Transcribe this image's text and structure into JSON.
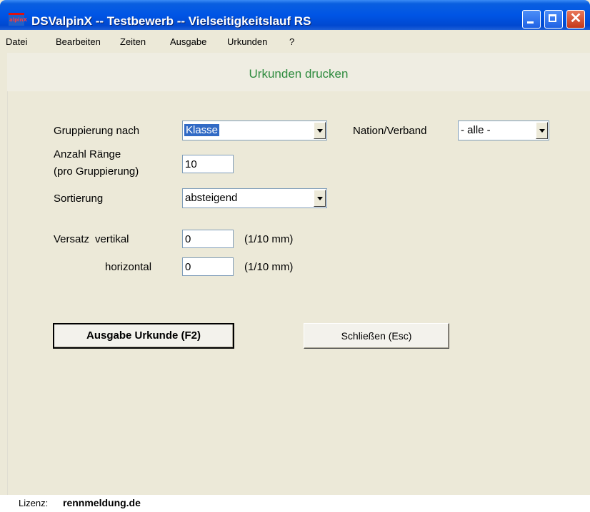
{
  "window": {
    "title": "DSValpinX -- Testbewerb -- Vielseitigkeitslauf RS",
    "icon_text": "alpinX"
  },
  "menu": [
    "Datei",
    "Bearbeiten",
    "Zeiten",
    "Ausgabe",
    "Urkunden",
    "?"
  ],
  "page": {
    "title": "Urkunden drucken"
  },
  "form": {
    "grouping": {
      "label": "Gruppierung nach",
      "value": "Klasse"
    },
    "nation": {
      "label": "Nation/Verband",
      "value": "- alle -"
    },
    "ranks": {
      "label_line1": "Anzahl Ränge",
      "label_line2": "(pro Gruppierung)",
      "value": "10"
    },
    "sort": {
      "label": "Sortierung",
      "value": "absteigend"
    },
    "offset": {
      "label": "Versatz",
      "vertical_label": "vertikal",
      "vertical_value": "0",
      "horizontal_label": "horizontal",
      "horizontal_value": "0",
      "unit": "(1/10 mm)"
    }
  },
  "buttons": {
    "print": "Ausgabe Urkunde (F2)",
    "close": "Schließen (Esc)"
  },
  "status": {
    "label": "Lizenz:",
    "value": "rennmeldung.de"
  }
}
